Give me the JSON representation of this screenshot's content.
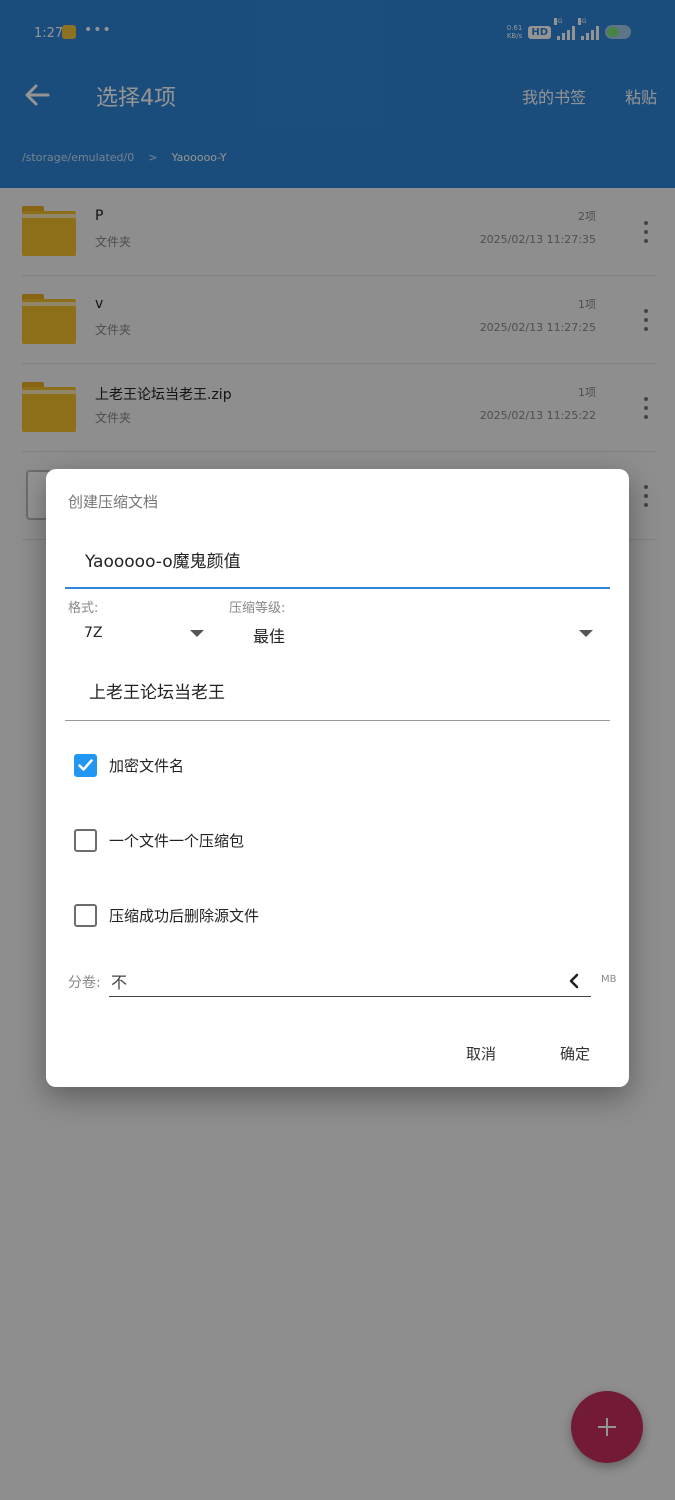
{
  "status_bar": {
    "time": "1:27",
    "dots": "•••",
    "net_speed_value": "0.61",
    "net_speed_unit": "KB/s",
    "hd": "HD",
    "sig1_label": "5G",
    "sig2_label": "5G"
  },
  "toolbar": {
    "title": "选择4项",
    "bookmarks": "我的书签",
    "paste": "粘贴"
  },
  "breadcrumb": {
    "path": "/storage/emulated/0",
    "separator": ">",
    "current": "Yaooooo-Y"
  },
  "files": [
    {
      "name": "P",
      "type": "文件夹",
      "count": "2项",
      "date": "2025/02/13 11:27:35"
    },
    {
      "name": "v",
      "type": "文件夹",
      "count": "1项",
      "date": "2025/02/13 11:27:25"
    },
    {
      "name": "上老王论坛当老王.zip",
      "type": "文件夹",
      "count": "1项",
      "date": "2025/02/13 11:25:22"
    }
  ],
  "dialog": {
    "title": "创建压缩文档",
    "filename": "Yaooooo-o魔鬼颜值",
    "format_label": "格式:",
    "format_value": "7Z",
    "level_label": "压缩等级:",
    "level_value": "最佳",
    "password": "上老王论坛当老王",
    "options": [
      {
        "label": "加密文件名",
        "checked": true
      },
      {
        "label": "一个文件一个压缩包",
        "checked": false
      },
      {
        "label": "压缩成功后删除源文件",
        "checked": false
      }
    ],
    "volume_label": "分卷:",
    "volume_value": "不",
    "volume_unit": "MB",
    "cancel": "取消",
    "ok": "确定"
  },
  "colors": {
    "appbar": "#2f86d6",
    "accent": "#2196f3",
    "fab": "#c7305c",
    "folder": "#f5c02c"
  }
}
